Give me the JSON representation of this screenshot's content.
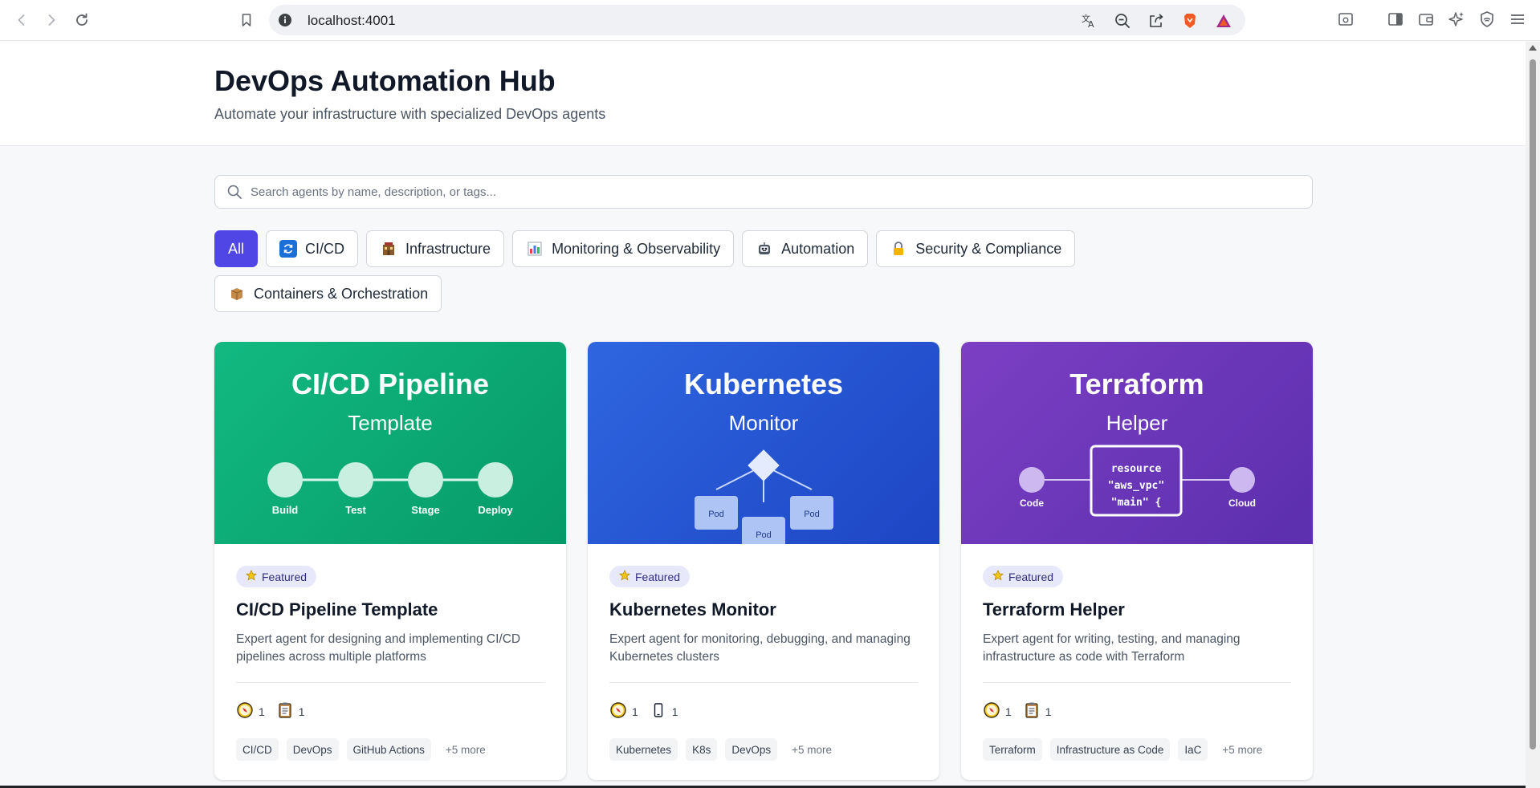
{
  "browser": {
    "url": "localhost:4001"
  },
  "header": {
    "title": "DevOps Automation Hub",
    "subtitle": "Automate your infrastructure with specialized DevOps agents"
  },
  "search": {
    "placeholder": "Search agents by name, description, or tags...",
    "value": ""
  },
  "filters": [
    {
      "label": "All",
      "icon": "",
      "active": true
    },
    {
      "label": "CI/CD",
      "icon": "refresh-icon"
    },
    {
      "label": "Infrastructure",
      "icon": "building-icon"
    },
    {
      "label": "Monitoring & Observability",
      "icon": "bar-chart-icon"
    },
    {
      "label": "Automation",
      "icon": "robot-icon"
    },
    {
      "label": "Security & Compliance",
      "icon": "lock-icon"
    },
    {
      "label": "Containers & Orchestration",
      "icon": "package-icon"
    }
  ],
  "cards": [
    {
      "hero_title": "CI/CD Pipeline",
      "hero_subtitle": "Template",
      "hero_stages": [
        "Build",
        "Test",
        "Stage",
        "Deploy"
      ],
      "hero_gradient": [
        "#12b981",
        "#069a68"
      ],
      "badge": "Featured",
      "title": "CI/CD Pipeline Template",
      "description": "Expert agent for designing and implementing CI/CD pipelines across multiple platforms",
      "stats": [
        {
          "icon": "compass-icon",
          "value": "1"
        },
        {
          "icon": "clipboard-icon",
          "value": "1"
        }
      ],
      "tags": [
        "CI/CD",
        "DevOps",
        "GitHub Actions"
      ],
      "more": "+5 more"
    },
    {
      "hero_title": "Kubernetes",
      "hero_subtitle": "Monitor",
      "hero_pods": [
        "Pod",
        "Pod",
        "Pod"
      ],
      "hero_gradient": [
        "#2f66e0",
        "#1d45c4"
      ],
      "badge": "Featured",
      "title": "Kubernetes Monitor",
      "description": "Expert agent for monitoring, debugging, and managing Kubernetes clusters",
      "stats": [
        {
          "icon": "compass-icon",
          "value": "1"
        },
        {
          "icon": "phone-icon",
          "value": "1"
        }
      ],
      "tags": [
        "Kubernetes",
        "K8s",
        "DevOps"
      ],
      "more": "+5 more"
    },
    {
      "hero_title": "Terraform",
      "hero_subtitle": "Helper",
      "hero_code": [
        "resource",
        "\"aws_vpc\"",
        "\"main\" {"
      ],
      "hero_left_label": "Code",
      "hero_right_label": "Cloud",
      "hero_gradient": [
        "#7c3fc4",
        "#5b2fae"
      ],
      "badge": "Featured",
      "title": "Terraform Helper",
      "description": "Expert agent for writing, testing, and managing infrastructure as code with Terraform",
      "stats": [
        {
          "icon": "compass-icon",
          "value": "1"
        },
        {
          "icon": "clipboard-icon",
          "value": "1"
        }
      ],
      "tags": [
        "Terraform",
        "Infrastructure as Code",
        "IaC"
      ],
      "more": "+5 more"
    }
  ]
}
